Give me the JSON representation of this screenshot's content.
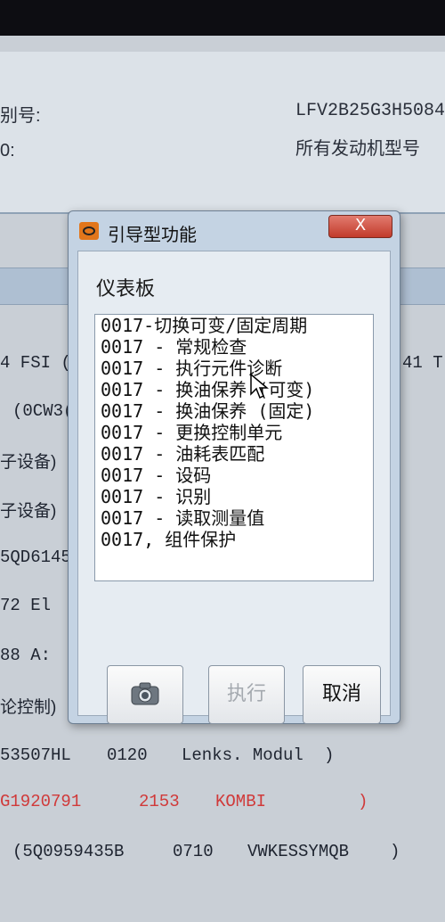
{
  "header": {
    "vin_label": "别号:",
    "vin_value": "LFV2B25G3H5084",
    "colon_label": "0:",
    "engine_type": "所有发动机型号"
  },
  "background_rows": [
    {
      "left": "4 FSI (",
      "right": "41 T"
    },
    {
      "left": "(0CW3("
    },
    {
      "left": "子设备)"
    },
    {
      "left": "子设备)"
    },
    {
      "left": "5QD6145"
    },
    {
      "left": "72   El"
    },
    {
      "left": "88   A:"
    },
    {
      "left": "论控制)"
    }
  ],
  "module_rows": [
    {
      "part": "53507HL",
      "code": "0120",
      "name": "Lenks. Modul",
      "close": ")"
    },
    {
      "part": "G1920791",
      "code": "2153",
      "name": "KOMBI",
      "close": ")"
    },
    {
      "part": "(5Q0959435B",
      "code": "0710",
      "name": "VWKESSYMQB",
      "close": ")"
    }
  ],
  "dialog": {
    "title": "引导型功能",
    "close_label": "X",
    "section_title": "仪表板",
    "items": [
      "0017-切换可变/固定周期",
      "0017 - 常规检查",
      "0017 - 执行元件诊断",
      "0017 - 换油保养 (可变)",
      "0017 - 换油保养 (固定)",
      "0017 - 更换控制单元",
      "0017 - 油耗表匹配",
      "0017 - 设码",
      "0017 - 识别",
      "0017 - 读取测量值",
      "0017, 组件保护"
    ],
    "buttons": {
      "screenshot_icon": "camera-icon",
      "execute_label": "执行",
      "cancel_label": "取消"
    }
  }
}
